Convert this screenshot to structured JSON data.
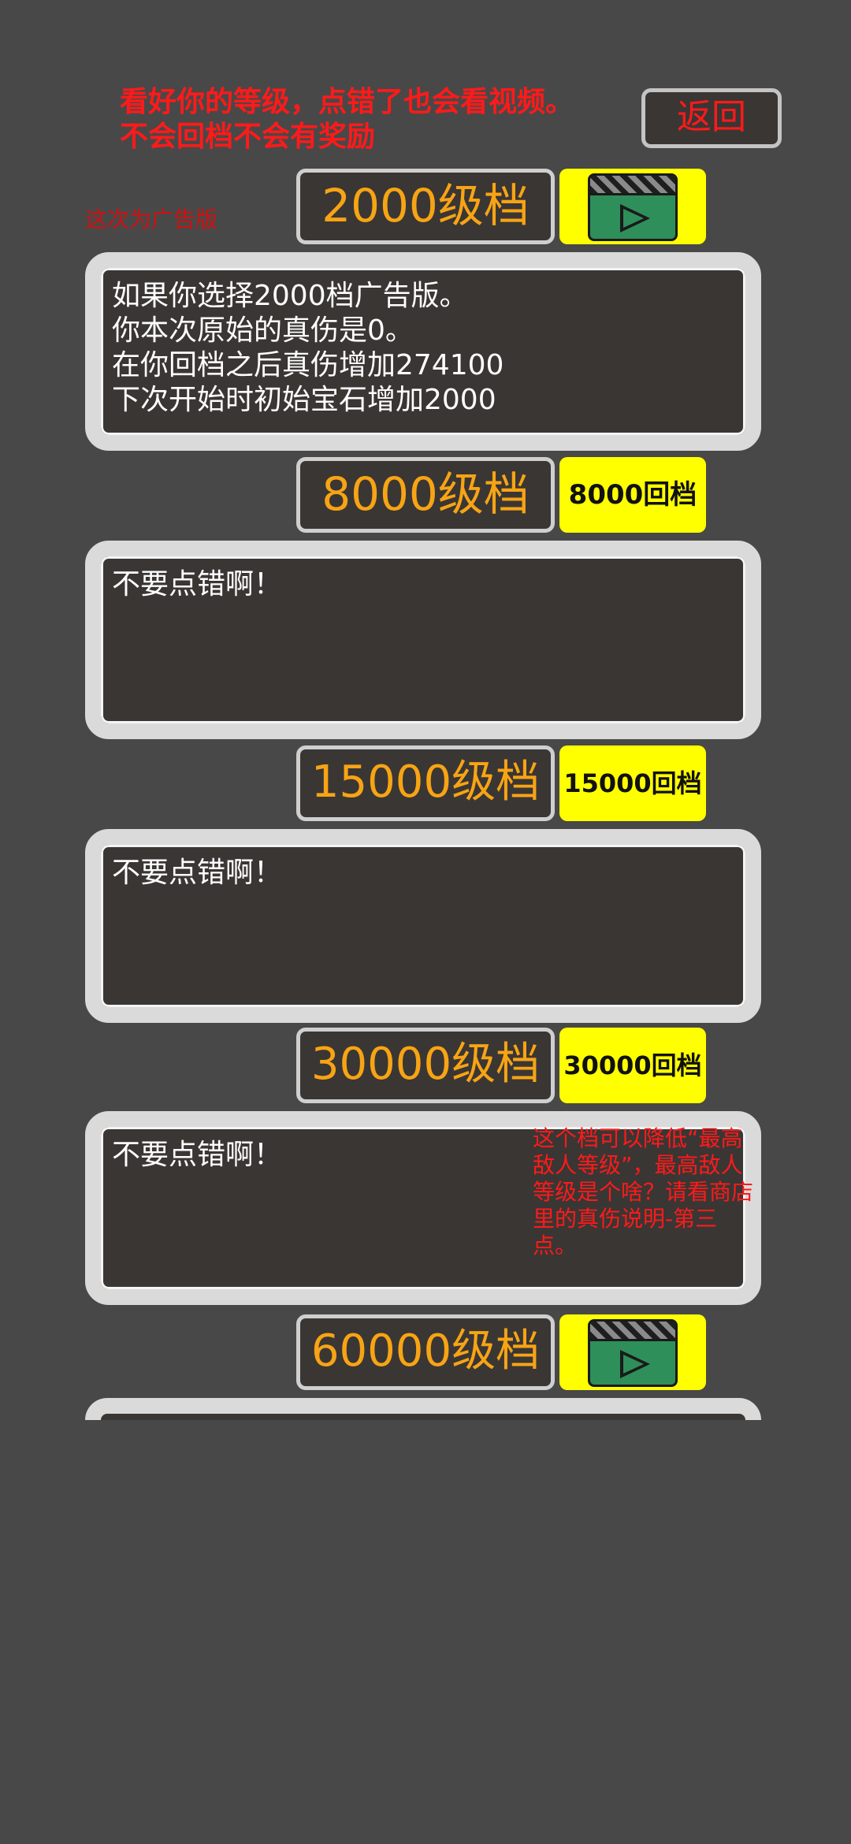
{
  "header": {
    "warning": "看好你的等级，点错了也会看视频。\n不会回档不会有奖励",
    "back_label": "返回",
    "ad_note": "这次为广告版"
  },
  "tiers": [
    {
      "level_label": "2000级档",
      "action": "video-icon",
      "info": "如果你选择2000档广告版。\n你本次原始的真伤是0。\n在你回档之后真伤增加274100\n下次开始时初始宝石增加2000"
    },
    {
      "level_label": "8000级档",
      "action_label": "8000回档",
      "info": "不要点错啊！"
    },
    {
      "level_label": "15000级档",
      "action_label": "15000回档",
      "info": "不要点错啊！"
    },
    {
      "level_label": "30000级档",
      "action_label": "30000回档",
      "info": "不要点错啊！",
      "note": "这个档可以降低“最高敌人等级”，最高敌人等级是个啥？请看商店里的真伤说明-第三点。"
    },
    {
      "level_label": "60000级档",
      "action": "video-icon"
    }
  ],
  "colors": {
    "background": "#484848",
    "panel": "#3a3634",
    "level_text": "#f7a414",
    "action_bg": "#ffff00",
    "warning": "#ff1a1a"
  }
}
